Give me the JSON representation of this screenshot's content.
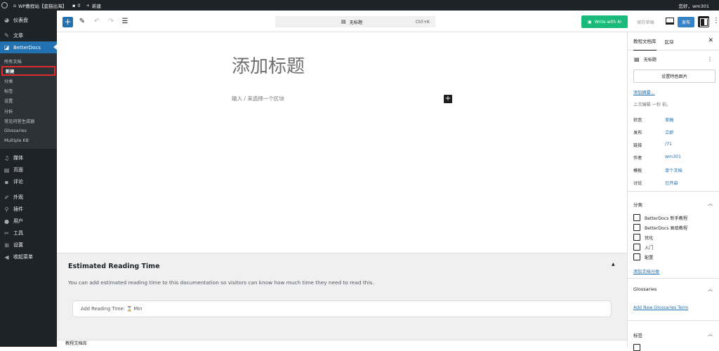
{
  "admin_bar": {
    "site_name": "WP教程站【歪猫出海】",
    "comments_count": "0",
    "new_label": "新建",
    "howdy": "您好，wm301"
  },
  "sidebar": {
    "dashboard": "仪表盘",
    "posts": "文章",
    "betterdocs": "BetterDocs",
    "sub_items": [
      "所有文档",
      "新建",
      "分类",
      "标签",
      "设置",
      "分析",
      "常见问答生成器",
      "Glossaries",
      "Multiple KB"
    ],
    "media": "媒体",
    "pages": "页面",
    "comments": "评论",
    "appearance": "外观",
    "plugins": "插件",
    "users": "用户",
    "tools": "工具",
    "settings": "设置",
    "collapse": "收起菜单"
  },
  "toolbar": {
    "doc_title": "无标题",
    "shortcut": "Ctrl+K",
    "ai_button": "Write with AI",
    "save_draft": "保存草稿",
    "publish": "发布"
  },
  "editor": {
    "title_placeholder": "添加标题",
    "block_placeholder": "输入 / 来选择一个区块"
  },
  "metabox": {
    "title": "Estimated Reading Time",
    "description": "You can add estimated reading time to this documentation so visitors can know how much time they need to read this.",
    "input_placeholder": "Add Reading Time: ⌛ Min"
  },
  "footer": {
    "breadcrumb": "教程文档库"
  },
  "panel": {
    "tab_doc": "教程文档库",
    "tab_block": "区块",
    "doc_name": "无标题",
    "featured_image": "设置特色图片",
    "add_excerpt": "添加摘要...",
    "last_edited": "上次编辑 一秒 前。",
    "props": [
      {
        "k": "状态",
        "v": "草稿"
      },
      {
        "k": "发布",
        "v": "立即"
      },
      {
        "k": "链接",
        "v": "/71"
      },
      {
        "k": "作者",
        "v": "wm301"
      },
      {
        "k": "模板",
        "v": "单个文档"
      },
      {
        "k": "讨论",
        "v": "已开启"
      }
    ],
    "categories_title": "分类",
    "categories": [
      "BetterDocs 新手教程",
      "BetterDocs 高级教程",
      "优化",
      "入门",
      "配置"
    ],
    "add_category": "添加文档分类",
    "glossaries_title": "Glossaries",
    "add_glossary": "Add New Glossaries Term",
    "tags_title": "标签"
  }
}
